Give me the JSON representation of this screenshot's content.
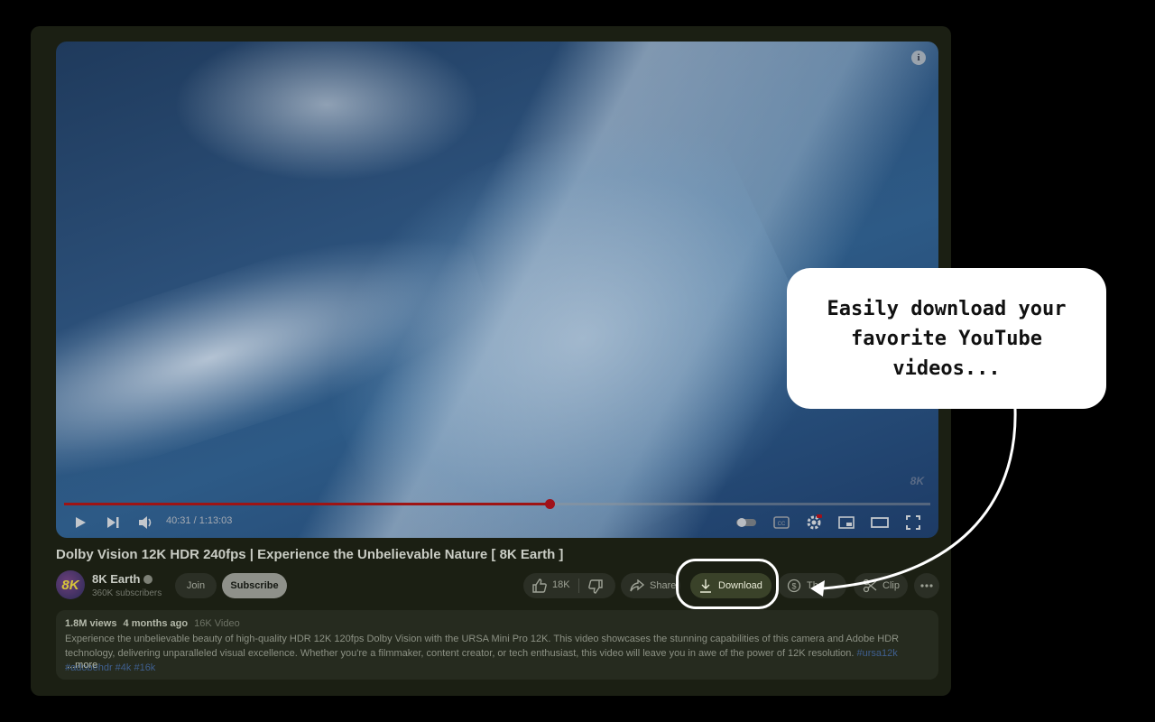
{
  "video": {
    "title": "Dolby Vision 12K HDR 240fps | Experience the Unbelievable Nature [ 8K Earth ]",
    "watermark": "8K",
    "progress_fraction": 0.56,
    "time_current": "40:31",
    "time_total": "1:13:03",
    "time_display": "40:31 / 1:13:03"
  },
  "channel": {
    "avatar_text": "8K",
    "name": "8K Earth",
    "subscribers": "360K subscribers",
    "join_label": "Join",
    "subscribe_label": "Subscribe"
  },
  "actions": {
    "like_count": "18K",
    "share_label": "Share",
    "download_label": "Download",
    "thanks_label": "Th",
    "clip_label": "Clip"
  },
  "description": {
    "views": "1.8M views",
    "age": "4 months ago",
    "tag": "16K Video",
    "text": "Experience the unbelievable beauty of high-quality HDR 12K 120fps Dolby Vision with the URSA Mini Pro 12K. This video showcases the stunning capabilities of this camera and Adobe HDR technology, delivering unparalleled visual excellence. Whether you're a filmmaker, content creator, or tech enthusiast, this video will leave you in awe of the power of 12K resolution.",
    "hashtags": "#ursa12k #adobehdr #4k #16k",
    "more_label": "...more"
  },
  "callout": {
    "text": "Easily download your favorite YouTube videos..."
  },
  "colors": {
    "progress": "#9e1414",
    "download_ring": "#ffffff",
    "background": "#000000"
  }
}
